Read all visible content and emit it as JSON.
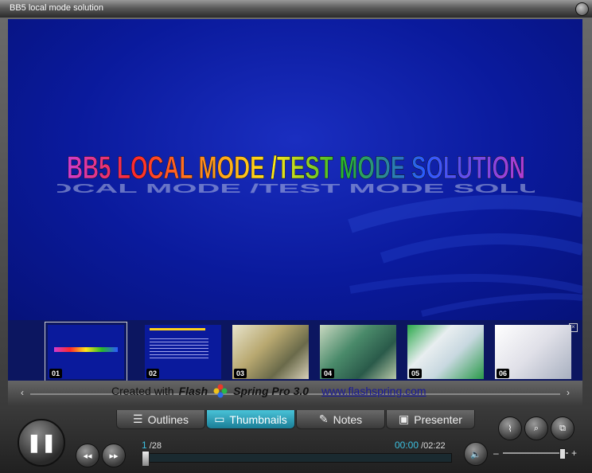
{
  "window": {
    "title": "BB5 local mode solution"
  },
  "slide": {
    "title": "BB5 LOCAL MODE /TEST MODE SOLUTION"
  },
  "thumbnails": [
    {
      "num": "01",
      "selected": true
    },
    {
      "num": "02",
      "selected": false
    },
    {
      "num": "03",
      "selected": false
    },
    {
      "num": "04",
      "selected": false
    },
    {
      "num": "05",
      "selected": false
    },
    {
      "num": "06",
      "selected": false
    }
  ],
  "credit": {
    "prefix": "Created with",
    "brand_a": "Flash",
    "brand_b": "Spring Pro 3.0",
    "url": "www.flashspring.com"
  },
  "tabs": [
    {
      "label": "Outlines",
      "icon": "outline-icon"
    },
    {
      "label": "Thumbnails",
      "icon": "thumbnails-icon"
    },
    {
      "label": "Notes",
      "icon": "pencil-icon"
    },
    {
      "label": "Presenter",
      "icon": "presenter-icon"
    }
  ],
  "playback": {
    "current_page": "1",
    "total_pages": "/28",
    "current_time": "00:00",
    "total_time": "/02:22",
    "progress": 0.02,
    "volume": 0.9
  },
  "volume_labels": {
    "minus": "–",
    "plus": "+"
  },
  "colors": {
    "accent": "#3cc0e0",
    "slide_bg": "#0a1a9c",
    "strip_bg": "#0c1660"
  }
}
